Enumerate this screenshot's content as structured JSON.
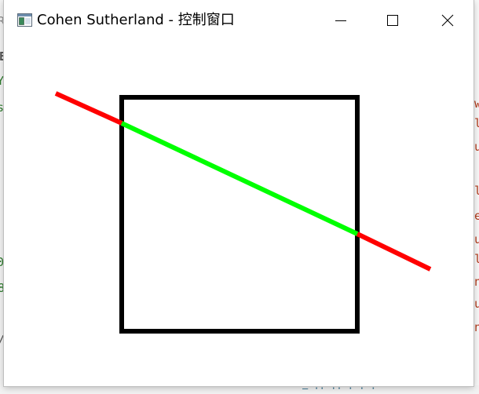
{
  "window": {
    "title": "Cohen Sutherland - 控制窗口",
    "controls": {
      "minimize_icon": "minimize-icon",
      "maximize_icon": "maximize-icon",
      "close_icon": "close-icon"
    }
  },
  "scene": {
    "clip_rect_color": "#000000",
    "clipped_out_color": "#ff0000",
    "clipped_in_color": "#00ff00"
  },
  "background_editor": {
    "left_fragments": [
      "R",
      "E",
      "Y",
      "s",
      "0",
      "8",
      "/"
    ],
    "right_fragments": [
      "w",
      "l",
      "u",
      "l",
      "e",
      "u",
      "l",
      "n",
      "u",
      "n"
    ],
    "bottom_fragment": "— ·· ·· · · ·"
  }
}
